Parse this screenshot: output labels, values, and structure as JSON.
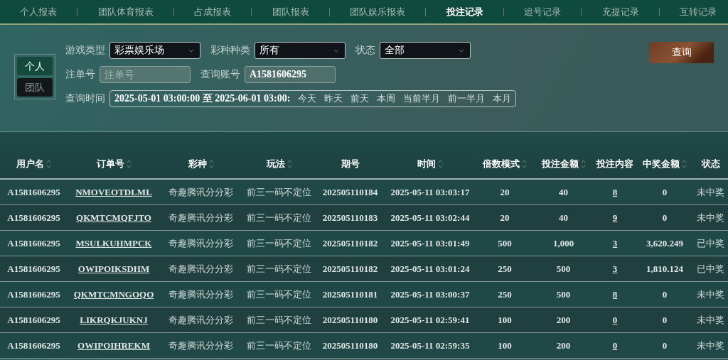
{
  "tabs": [
    {
      "label": "个人报表",
      "selected": false
    },
    {
      "label": "团队体育报表",
      "selected": false
    },
    {
      "label": "占成报表",
      "selected": false
    },
    {
      "label": "团队报表",
      "selected": false
    },
    {
      "label": "团队娱乐报表",
      "selected": false
    },
    {
      "label": "投注记录",
      "selected": true
    },
    {
      "label": "追号记录",
      "selected": false
    },
    {
      "label": "充提记录",
      "selected": false
    },
    {
      "label": "互转记录",
      "selected": false
    }
  ],
  "scope": [
    {
      "label": "个人",
      "selected": true
    },
    {
      "label": "团队",
      "selected": false
    }
  ],
  "filters": {
    "game_type": {
      "label": "游戏类型",
      "value": "彩票娱乐场"
    },
    "lottery_kind": {
      "label": "彩种种类",
      "value": "所有"
    },
    "status": {
      "label": "状态",
      "value": "全部"
    },
    "order_no": {
      "label": "注单号",
      "placeholder": "注单号"
    },
    "account": {
      "label": "查询账号",
      "value": "A1581606295"
    },
    "time": {
      "label": "查询时间",
      "value": "2025-05-01 03:00:00 至 2025-06-01 03:00:",
      "shortcuts": [
        "今天",
        "昨天",
        "前天",
        "本周",
        "当前半月",
        "前一半月",
        "本月"
      ]
    }
  },
  "query_button": "查询",
  "table": {
    "columns": [
      {
        "label": "用户名",
        "sortable": true
      },
      {
        "label": "订单号",
        "sortable": true
      },
      {
        "label": "彩种",
        "sortable": true
      },
      {
        "label": "玩法",
        "sortable": true
      },
      {
        "label": "期号",
        "sortable": false
      },
      {
        "label": "时间",
        "sortable": true
      },
      {
        "label": "倍数模式",
        "sortable": true
      },
      {
        "label": "投注金额",
        "sortable": true
      },
      {
        "label": "投注内容",
        "sortable": false
      },
      {
        "label": "中奖金额",
        "sortable": true
      },
      {
        "label": "状态",
        "sortable": false
      }
    ],
    "rows": [
      [
        "A1581606295",
        "NMOVEOTDLML",
        "奇趣腾讯分分彩",
        "前三一码不定位",
        "202505110184",
        "2025-05-11 03:03:17",
        "20",
        "40",
        "8",
        "0",
        "未中奖"
      ],
      [
        "A1581606295",
        "QKMTCMQFJTO",
        "奇趣腾讯分分彩",
        "前三一码不定位",
        "202505110183",
        "2025-05-11 03:02:44",
        "20",
        "40",
        "9",
        "0",
        "未中奖"
      ],
      [
        "A1581606295",
        "MSULKUHMPCK",
        "奇趣腾讯分分彩",
        "前三一码不定位",
        "202505110182",
        "2025-05-11 03:01:49",
        "500",
        "1,000",
        "3",
        "3,620.249",
        "已中奖"
      ],
      [
        "A1581606295",
        "OWIPOIKSDHM",
        "奇趣腾讯分分彩",
        "前三一码不定位",
        "202505110182",
        "2025-05-11 03:01:24",
        "250",
        "500",
        "3",
        "1,810.124",
        "已中奖"
      ],
      [
        "A1581606295",
        "QKMTCMNGOQO",
        "奇趣腾讯分分彩",
        "前三一码不定位",
        "202505110181",
        "2025-05-11 03:00:37",
        "250",
        "500",
        "8",
        "0",
        "未中奖"
      ],
      [
        "A1581606295",
        "LIKRQKJUKNJ",
        "奇趣腾讯分分彩",
        "前三一码不定位",
        "202505110180",
        "2025-05-11 02:59:41",
        "100",
        "200",
        "0",
        "0",
        "未中奖"
      ],
      [
        "A1581606295",
        "OWIPOIHREKM",
        "奇趣腾讯分分彩",
        "前三一码不定位",
        "202505110180",
        "2025-05-11 02:59:35",
        "100",
        "200",
        "0",
        "0",
        "未中奖"
      ]
    ]
  }
}
